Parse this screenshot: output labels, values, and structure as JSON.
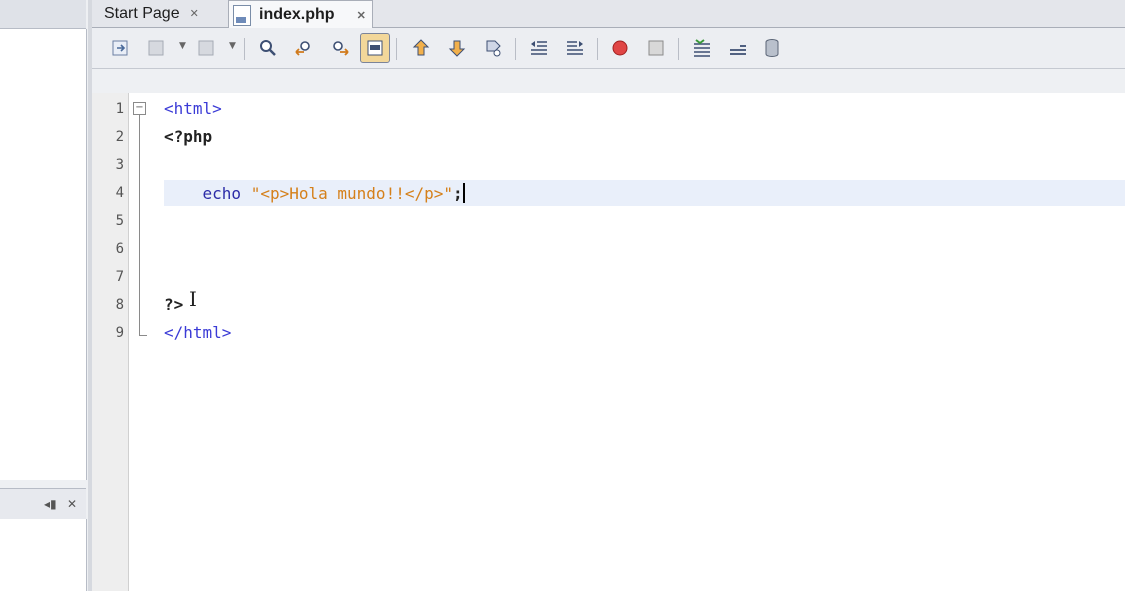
{
  "tabs": [
    {
      "label": "Start Page",
      "close": "✕"
    },
    {
      "label": "index.php",
      "close": "✕"
    }
  ],
  "side_panel": {
    "ctrl_left": "◂▮",
    "ctrl_close": "✕"
  },
  "toolbar": {
    "icons": [
      "last-edit-icon",
      "back-icon",
      "forward-icon",
      "find-icon",
      "find-previous-icon",
      "find-next-icon",
      "toggle-highlight-icon",
      "previous-bookmark-icon",
      "next-bookmark-icon",
      "toggle-bookmark-icon",
      "shift-left-icon",
      "shift-right-icon",
      "start-macro-icon",
      "stop-macro-icon",
      "comment-icon",
      "uncomment-icon",
      "database-icon"
    ]
  },
  "editor": {
    "lines": [
      {
        "num": "1",
        "parts": [
          {
            "cls": "tag",
            "text": "<html>"
          }
        ]
      },
      {
        "num": "2",
        "parts": [
          {
            "cls": "php",
            "text": "<?php"
          }
        ]
      },
      {
        "num": "3",
        "parts": []
      },
      {
        "num": "4",
        "parts": [
          {
            "cls": "kw",
            "text": "    echo "
          },
          {
            "cls": "str",
            "text": "\"<p>Hola mundo!!</p>\""
          },
          {
            "cls": "php",
            "text": ";"
          }
        ]
      },
      {
        "num": "5",
        "parts": []
      },
      {
        "num": "6",
        "parts": []
      },
      {
        "num": "7",
        "parts": []
      },
      {
        "num": "8",
        "parts": [
          {
            "cls": "php",
            "text": "?>"
          }
        ]
      },
      {
        "num": "9",
        "parts": [
          {
            "cls": "tag",
            "text": "</html>"
          }
        ]
      }
    ],
    "current_line": 4,
    "fold_toggle": "−"
  },
  "colors": {
    "tag": "#3b3bd6",
    "string": "#d5801a",
    "keyword": "#2c2ca8",
    "current_line": "#e9effa"
  }
}
